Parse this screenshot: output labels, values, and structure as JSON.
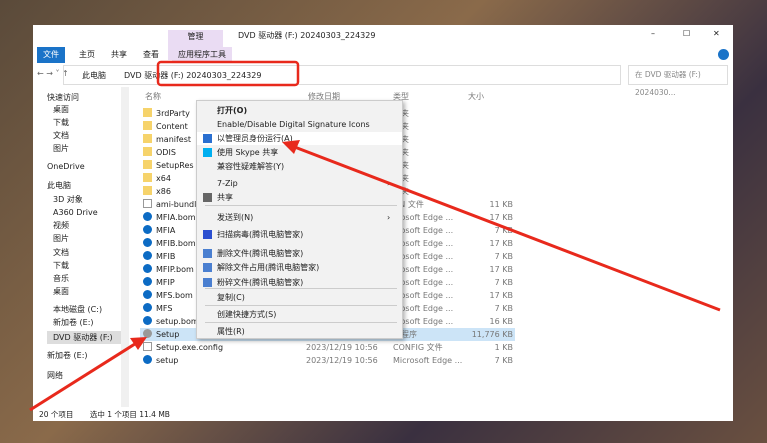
{
  "window": {
    "title": "DVD 驱动器 (F:) 20240303_224329",
    "context_tab": "管理",
    "minimize": "–",
    "maximize": "☐",
    "close": "✕"
  },
  "ribbon": {
    "tabs": [
      "文件",
      "主页",
      "共享",
      "查看",
      "应用程序工具"
    ]
  },
  "address": {
    "segments": [
      "此电脑",
      "DVD 驱动器 (F:) 20240303_224329"
    ],
    "search_placeholder": "在 DVD 驱动器 (F:) 2024030... "
  },
  "columns": {
    "name": "名称",
    "date": "修改日期",
    "type": "类型",
    "size": "大小"
  },
  "sidebar": [
    "快速访问",
    "桌面",
    "下载",
    "文档",
    "图片",
    "OneDrive",
    "此电脑",
    "3D 对象",
    "A360 Drive",
    "视频",
    "图片",
    "文档",
    "下载",
    "音乐",
    "桌面",
    "本地磁盘 (C:)",
    "新加卷 (E:)",
    "DVD 驱动器 (F:)",
    "新加卷 (E:)",
    "网络"
  ],
  "files": [
    {
      "name": "3rdParty",
      "date": "",
      "type": "件夹",
      "size": "",
      "icon": "folder"
    },
    {
      "name": "Content",
      "date": "",
      "type": "件夹",
      "size": "",
      "icon": "folder"
    },
    {
      "name": "manifest",
      "date": "",
      "type": "件夹",
      "size": "",
      "icon": "folder"
    },
    {
      "name": "ODIS",
      "date": "",
      "type": "件夹",
      "size": "",
      "icon": "folder"
    },
    {
      "name": "SetupRes",
      "date": "",
      "type": "件夹",
      "size": "",
      "icon": "folder"
    },
    {
      "name": "x64",
      "date": "",
      "type": "件夹",
      "size": "",
      "icon": "folder"
    },
    {
      "name": "x86",
      "date": "",
      "type": "件夹",
      "size": "",
      "icon": "folder"
    },
    {
      "name": "ami-bundle",
      "date": "",
      "type": "ON 文件",
      "size": "11 KB",
      "icon": "doc"
    },
    {
      "name": "MFIA.bom",
      "date": "",
      "type": "crosoft Edge ...",
      "size": "17 KB",
      "icon": "edge"
    },
    {
      "name": "MFIA",
      "date": "",
      "type": "crosoft Edge ...",
      "size": "7 KB",
      "icon": "edge"
    },
    {
      "name": "MFIB.bom",
      "date": "",
      "type": "crosoft Edge ...",
      "size": "17 KB",
      "icon": "edge"
    },
    {
      "name": "MFIB",
      "date": "",
      "type": "crosoft Edge ...",
      "size": "7 KB",
      "icon": "edge"
    },
    {
      "name": "MFIP.bom",
      "date": "",
      "type": "crosoft Edge ...",
      "size": "17 KB",
      "icon": "edge"
    },
    {
      "name": "MFIP",
      "date": "",
      "type": "crosoft Edge ...",
      "size": "7 KB",
      "icon": "edge"
    },
    {
      "name": "MFS.bom",
      "date": "",
      "type": "crosoft Edge ...",
      "size": "17 KB",
      "icon": "edge"
    },
    {
      "name": "MFS",
      "date": "",
      "type": "crosoft Edge ...",
      "size": "7 KB",
      "icon": "edge"
    },
    {
      "name": "setup.bom",
      "date": "",
      "type": "crosoft Edge ...",
      "size": "16 KB",
      "icon": "edge"
    },
    {
      "name": "Setup",
      "date": "",
      "type": "用程序",
      "size": "11,776 KB",
      "icon": "setup"
    },
    {
      "name": "Setup.exe.config",
      "date": "2023/12/19 10:56",
      "type": "CONFIG 文件",
      "size": "1 KB",
      "icon": "doc"
    },
    {
      "name": "setup",
      "date": "2023/12/19 10:56",
      "type": "Microsoft Edge ...",
      "size": "7 KB",
      "icon": "edge"
    }
  ],
  "menu": [
    "打开(O)",
    "Enable/Disable Digital Signature Icons",
    "以管理员身份运行(A)",
    "使用 Skype 共享",
    "兼容性疑难解答(Y)",
    "7-Zip",
    "共享",
    "发送到(N)",
    "扫描病毒(腾讯电脑管家)",
    "删除文件(腾讯电脑管家)",
    "解除文件占用(腾讯电脑管家)",
    "粉碎文件(腾讯电脑管家)",
    "复制(C)",
    "创建快捷方式(S)",
    "属性(R)"
  ],
  "status": {
    "count": "20 个项目",
    "selected": "选中 1 个项目  11.4 MB"
  },
  "colors": {
    "accent": "#1a73c8",
    "annotation": "#e8291c",
    "selection": "#cce4f7"
  }
}
